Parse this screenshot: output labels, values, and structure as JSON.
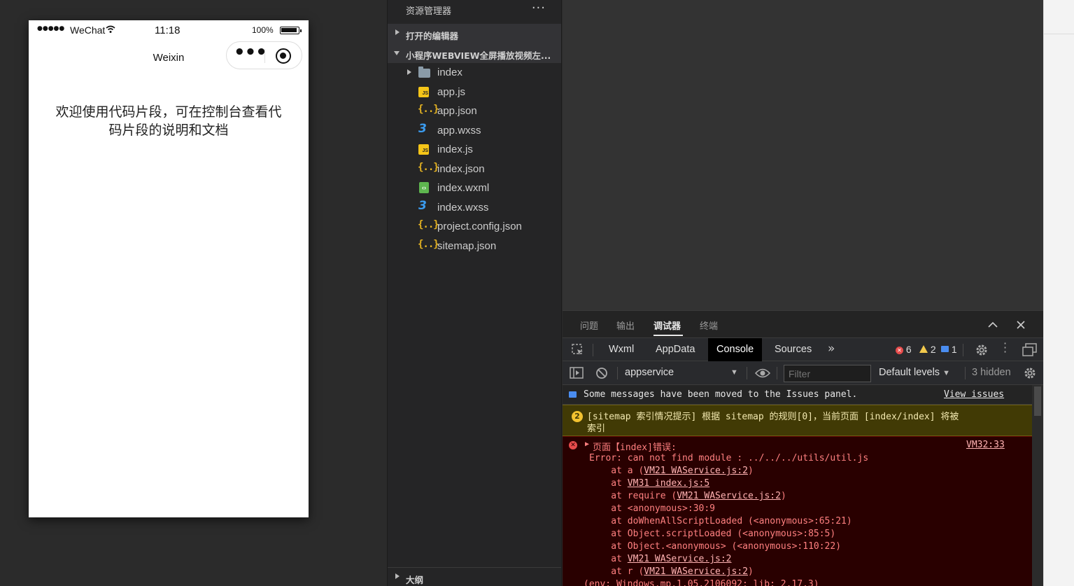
{
  "simulator": {
    "signal": "●●●●●",
    "carrier": "WeChat",
    "time": "11:18",
    "battery": "100%",
    "nav_title": "Weixin",
    "capsule_menu": "•••",
    "welcome_text": "欢迎使用代码片段，可在控制台查看代码片段的说明和文档"
  },
  "explorer": {
    "title": "资源管理器",
    "more": "···",
    "open_editors": "打开的编辑器",
    "project": "小程序WEBVIEW全屏播放视频左...",
    "folder": "index",
    "files": [
      {
        "name": "app.js",
        "icon": "js-file-icon"
      },
      {
        "name": "app.json",
        "icon": "json-file-icon"
      },
      {
        "name": "app.wxss",
        "icon": "css-file-icon"
      },
      {
        "name": "index.js",
        "icon": "js-file-icon"
      },
      {
        "name": "index.json",
        "icon": "json-file-icon"
      },
      {
        "name": "index.wxml",
        "icon": "wxml-file-icon"
      },
      {
        "name": "index.wxss",
        "icon": "css-file-icon"
      },
      {
        "name": "project.config.json",
        "icon": "json-file-icon"
      },
      {
        "name": "sitemap.json",
        "icon": "json-file-icon"
      }
    ],
    "outline": "大纲"
  },
  "panel": {
    "tabs": [
      "问题",
      "输出",
      "调试器",
      "终端"
    ],
    "active_tab": "调试器"
  },
  "devtools": {
    "tabs": [
      "Wxml",
      "AppData",
      "Console",
      "Sources"
    ],
    "active_tab": "Console",
    "more_tabs": "»",
    "error_count": "6",
    "warning_count": "2",
    "info_count": "1",
    "context": "appservice",
    "filter_placeholder": "Filter",
    "levels": "Default levels",
    "hidden": "3 hidden"
  },
  "console": {
    "info_message": "Some messages have been moved to the Issues panel.",
    "info_link": "View issues",
    "warn_count": "2",
    "warn_line1": "[sitemap 索引情况提示] 根据 sitemap 的规则[0]，当前页面 [index/index] 将被",
    "warn_line2": "索引",
    "err_title": "页面【index]错误:",
    "err_source": "VM32:33",
    "err_line": "Error: can not find module : ../../../utils/util.js",
    "stack": [
      {
        "pre": "    at a (",
        "link": "VM21 WAService.js:2",
        "post": ")"
      },
      {
        "pre": "    at ",
        "link": "VM31 index.js:5",
        "post": ""
      },
      {
        "pre": "    at require (",
        "link": "VM21 WAService.js:2",
        "post": ")"
      },
      {
        "pre": "    at <anonymous>:30:9",
        "link": "",
        "post": ""
      },
      {
        "pre": "    at doWhenAllScriptLoaded (<anonymous>:65:21)",
        "link": "",
        "post": ""
      },
      {
        "pre": "    at Object.scriptLoaded (<anonymous>:85:5)",
        "link": "",
        "post": ""
      },
      {
        "pre": "    at Object.<anonymous> (<anonymous>:110:22)",
        "link": "",
        "post": ""
      },
      {
        "pre": "    at ",
        "link": "VM21 WAService.js:2",
        "post": ""
      },
      {
        "pre": "    at r (",
        "link": "VM21 WAService.js:2",
        "post": ")"
      }
    ],
    "env_line": "(env: Windows,mp,1.05.2106092; lib: 2.17.3)"
  },
  "colors": {
    "error": "#e74c4c",
    "warning": "#f2c230",
    "info": "#4a8df0",
    "error_bg": "#290000",
    "warning_bg": "#413a05"
  }
}
